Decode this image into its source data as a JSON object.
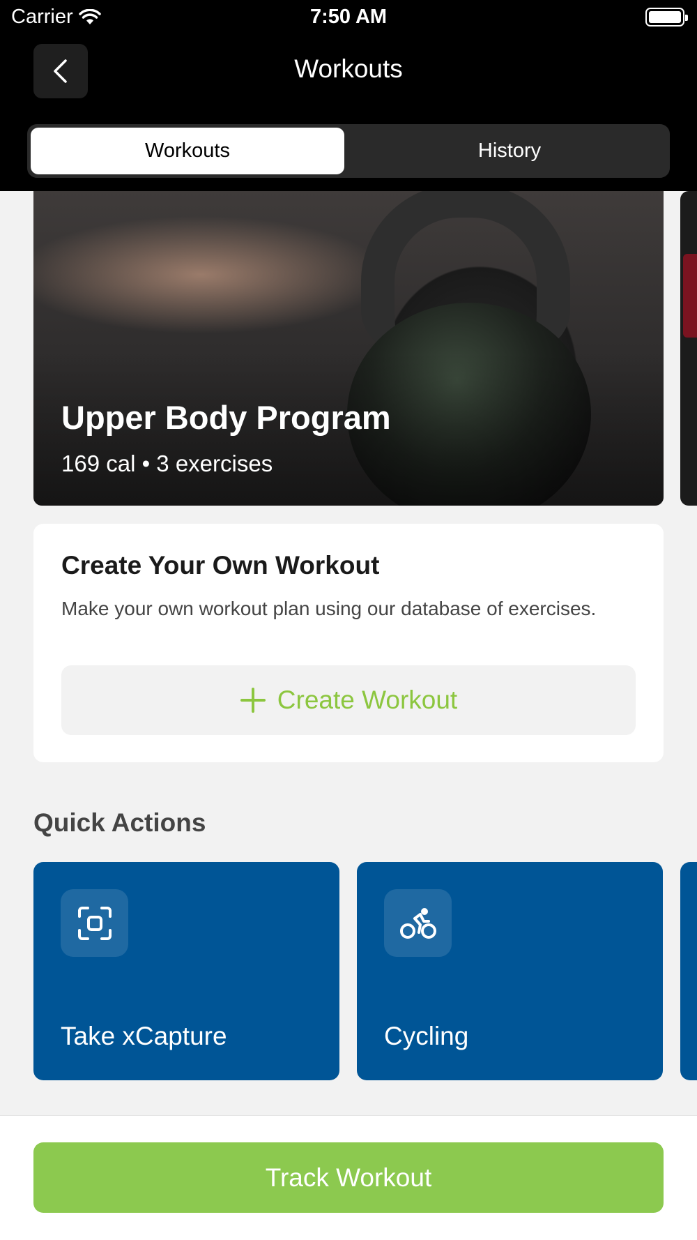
{
  "status_bar": {
    "carrier": "Carrier",
    "time": "7:50 AM"
  },
  "header": {
    "title": "Workouts",
    "back_icon": "chevron-left-icon"
  },
  "tabs": [
    {
      "label": "Workouts",
      "active": true
    },
    {
      "label": "History",
      "active": false
    }
  ],
  "featured": {
    "title": "Upper Body Program",
    "subtitle": "169 cal • 3 exercises"
  },
  "create_card": {
    "title": "Create Your Own Workout",
    "description": "Make your own workout plan using our database of exercises.",
    "button_label": "Create Workout",
    "button_icon": "plus-icon"
  },
  "quick_actions": {
    "title": "Quick Actions",
    "items": [
      {
        "label": "Take xCapture",
        "icon": "scan-icon"
      },
      {
        "label": "Cycling",
        "icon": "bicycle-icon"
      }
    ]
  },
  "footer": {
    "button_label": "Track Workout"
  },
  "colors": {
    "accent_green": "#8cc94f",
    "action_blue": "#005596",
    "header_bg": "#000000",
    "page_bg": "#f2f2f2"
  }
}
